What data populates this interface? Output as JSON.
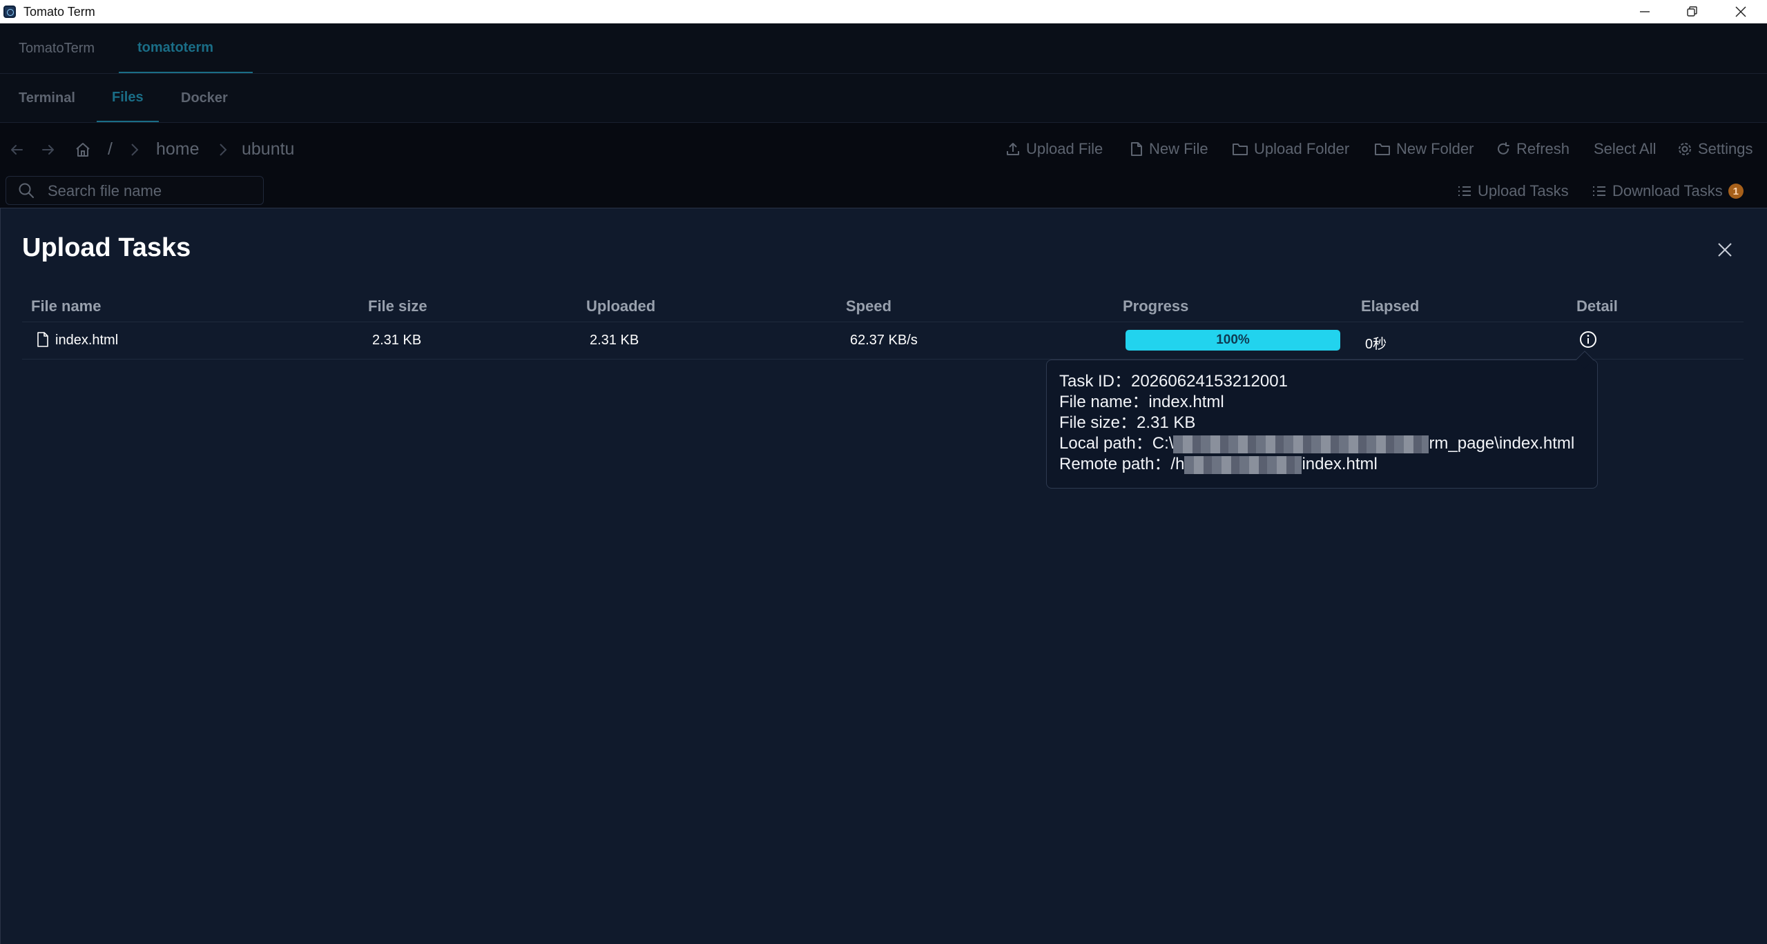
{
  "window": {
    "title": "Tomato Term"
  },
  "workspace_tabs": [
    {
      "label": "TomatoTerm",
      "active": false
    },
    {
      "label": "tomatoterm",
      "active": true
    }
  ],
  "sub_tabs": [
    {
      "label": "Terminal",
      "active": false
    },
    {
      "label": "Files",
      "active": true
    },
    {
      "label": "Docker",
      "active": false
    }
  ],
  "breadcrumb": {
    "root": "/",
    "segments": [
      "home",
      "ubuntu"
    ]
  },
  "toolbar": {
    "upload_file": "Upload File",
    "new_file": "New File",
    "upload_folder": "Upload Folder",
    "new_folder": "New Folder",
    "refresh": "Refresh",
    "select_all": "Select All",
    "settings": "Settings",
    "upload_tasks": "Upload Tasks",
    "download_tasks": "Download Tasks",
    "download_tasks_count": "1"
  },
  "search": {
    "placeholder": "Search file name",
    "value": ""
  },
  "upload_panel": {
    "title": "Upload Tasks",
    "columns": [
      "File name",
      "File size",
      "Uploaded",
      "Speed",
      "Progress",
      "Elapsed",
      "Detail"
    ],
    "rows": [
      {
        "file_name": "index.html",
        "file_size": "2.31 KB",
        "uploaded": "2.31 KB",
        "speed": "62.37 KB/s",
        "progress": 100,
        "progress_label": "100%",
        "elapsed": "0秒"
      }
    ]
  },
  "tooltip": {
    "task_id_label": "Task ID：",
    "task_id": "20260624153212001",
    "file_name_label": "File name：",
    "file_name": "index.html",
    "file_size_label": "File size：",
    "file_size": "2.31 KB",
    "local_path_label": "Local path：",
    "local_path_start": "C:\\",
    "local_path_end": "rm_page\\index.html",
    "remote_path_label": "Remote path：",
    "remote_path_start": "/h",
    "remote_path_end": "index.html"
  },
  "colors": {
    "accent": "#1a6d86",
    "progress": "#22d3ee",
    "badge": "#a7601a",
    "panel_bg": "#101a2c"
  }
}
